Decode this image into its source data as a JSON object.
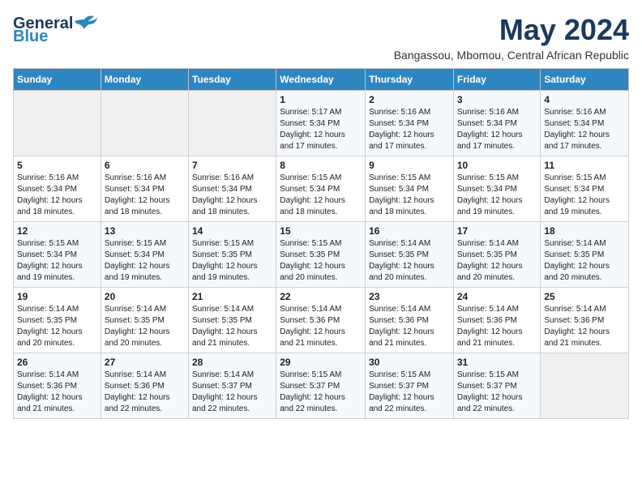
{
  "logo": {
    "line1": "General",
    "line2": "Blue"
  },
  "title": "May 2024",
  "location": "Bangassou, Mbomou, Central African Republic",
  "days_header": [
    "Sunday",
    "Monday",
    "Tuesday",
    "Wednesday",
    "Thursday",
    "Friday",
    "Saturday"
  ],
  "weeks": [
    [
      {
        "day": "",
        "info": ""
      },
      {
        "day": "",
        "info": ""
      },
      {
        "day": "",
        "info": ""
      },
      {
        "day": "1",
        "info": "Sunrise: 5:17 AM\nSunset: 5:34 PM\nDaylight: 12 hours\nand 17 minutes."
      },
      {
        "day": "2",
        "info": "Sunrise: 5:16 AM\nSunset: 5:34 PM\nDaylight: 12 hours\nand 17 minutes."
      },
      {
        "day": "3",
        "info": "Sunrise: 5:16 AM\nSunset: 5:34 PM\nDaylight: 12 hours\nand 17 minutes."
      },
      {
        "day": "4",
        "info": "Sunrise: 5:16 AM\nSunset: 5:34 PM\nDaylight: 12 hours\nand 17 minutes."
      }
    ],
    [
      {
        "day": "5",
        "info": "Sunrise: 5:16 AM\nSunset: 5:34 PM\nDaylight: 12 hours\nand 18 minutes."
      },
      {
        "day": "6",
        "info": "Sunrise: 5:16 AM\nSunset: 5:34 PM\nDaylight: 12 hours\nand 18 minutes."
      },
      {
        "day": "7",
        "info": "Sunrise: 5:16 AM\nSunset: 5:34 PM\nDaylight: 12 hours\nand 18 minutes."
      },
      {
        "day": "8",
        "info": "Sunrise: 5:15 AM\nSunset: 5:34 PM\nDaylight: 12 hours\nand 18 minutes."
      },
      {
        "day": "9",
        "info": "Sunrise: 5:15 AM\nSunset: 5:34 PM\nDaylight: 12 hours\nand 18 minutes."
      },
      {
        "day": "10",
        "info": "Sunrise: 5:15 AM\nSunset: 5:34 PM\nDaylight: 12 hours\nand 19 minutes."
      },
      {
        "day": "11",
        "info": "Sunrise: 5:15 AM\nSunset: 5:34 PM\nDaylight: 12 hours\nand 19 minutes."
      }
    ],
    [
      {
        "day": "12",
        "info": "Sunrise: 5:15 AM\nSunset: 5:34 PM\nDaylight: 12 hours\nand 19 minutes."
      },
      {
        "day": "13",
        "info": "Sunrise: 5:15 AM\nSunset: 5:34 PM\nDaylight: 12 hours\nand 19 minutes."
      },
      {
        "day": "14",
        "info": "Sunrise: 5:15 AM\nSunset: 5:35 PM\nDaylight: 12 hours\nand 19 minutes."
      },
      {
        "day": "15",
        "info": "Sunrise: 5:15 AM\nSunset: 5:35 PM\nDaylight: 12 hours\nand 20 minutes."
      },
      {
        "day": "16",
        "info": "Sunrise: 5:14 AM\nSunset: 5:35 PM\nDaylight: 12 hours\nand 20 minutes."
      },
      {
        "day": "17",
        "info": "Sunrise: 5:14 AM\nSunset: 5:35 PM\nDaylight: 12 hours\nand 20 minutes."
      },
      {
        "day": "18",
        "info": "Sunrise: 5:14 AM\nSunset: 5:35 PM\nDaylight: 12 hours\nand 20 minutes."
      }
    ],
    [
      {
        "day": "19",
        "info": "Sunrise: 5:14 AM\nSunset: 5:35 PM\nDaylight: 12 hours\nand 20 minutes."
      },
      {
        "day": "20",
        "info": "Sunrise: 5:14 AM\nSunset: 5:35 PM\nDaylight: 12 hours\nand 20 minutes."
      },
      {
        "day": "21",
        "info": "Sunrise: 5:14 AM\nSunset: 5:35 PM\nDaylight: 12 hours\nand 21 minutes."
      },
      {
        "day": "22",
        "info": "Sunrise: 5:14 AM\nSunset: 5:36 PM\nDaylight: 12 hours\nand 21 minutes."
      },
      {
        "day": "23",
        "info": "Sunrise: 5:14 AM\nSunset: 5:36 PM\nDaylight: 12 hours\nand 21 minutes."
      },
      {
        "day": "24",
        "info": "Sunrise: 5:14 AM\nSunset: 5:36 PM\nDaylight: 12 hours\nand 21 minutes."
      },
      {
        "day": "25",
        "info": "Sunrise: 5:14 AM\nSunset: 5:36 PM\nDaylight: 12 hours\nand 21 minutes."
      }
    ],
    [
      {
        "day": "26",
        "info": "Sunrise: 5:14 AM\nSunset: 5:36 PM\nDaylight: 12 hours\nand 21 minutes."
      },
      {
        "day": "27",
        "info": "Sunrise: 5:14 AM\nSunset: 5:36 PM\nDaylight: 12 hours\nand 22 minutes."
      },
      {
        "day": "28",
        "info": "Sunrise: 5:14 AM\nSunset: 5:37 PM\nDaylight: 12 hours\nand 22 minutes."
      },
      {
        "day": "29",
        "info": "Sunrise: 5:15 AM\nSunset: 5:37 PM\nDaylight: 12 hours\nand 22 minutes."
      },
      {
        "day": "30",
        "info": "Sunrise: 5:15 AM\nSunset: 5:37 PM\nDaylight: 12 hours\nand 22 minutes."
      },
      {
        "day": "31",
        "info": "Sunrise: 5:15 AM\nSunset: 5:37 PM\nDaylight: 12 hours\nand 22 minutes."
      },
      {
        "day": "",
        "info": ""
      }
    ]
  ]
}
